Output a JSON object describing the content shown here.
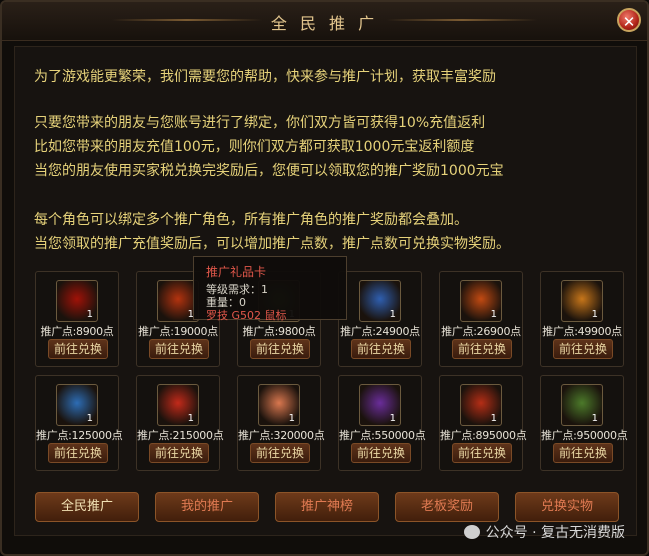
{
  "window": {
    "title": "全 民 推 广",
    "close_glyph": "✕"
  },
  "messages": [
    "为了游戏能更繁荣，我们需要您的帮助，快来参与推广计划，获取丰富奖励",
    "只要您带来的朋友与您账号进行了绑定，你们双方皆可获得10%充值返利",
    "比如您带来的朋友充值100元，则你们双方都可获取1000元宝返利额度",
    "当您的朋友使用买家税兑换完奖励后，您便可以领取您的推广奖励1000元宝",
    "每个角色可以绑定多个推广角色，所有推广角色的推广奖励都会叠加。",
    "当您领取的推广充值奖励后，可以增加推广点数，推广点数可兑换实物奖励。"
  ],
  "redeem_label": "前往兑换",
  "rewards": [
    {
      "cost": "推广点:8900点",
      "qty": "1",
      "icon": "red-envelope-icon",
      "color": "#a01208"
    },
    {
      "cost": "推广点:19000点",
      "qty": "1",
      "icon": "red-envelope-gold-icon",
      "color": "#b3330f"
    },
    {
      "cost": "推广点:9800点",
      "qty": "1",
      "icon": "gift-card-icon",
      "color": "#3c7a2c"
    },
    {
      "cost": "推广点:24900点",
      "qty": "1",
      "icon": "envelope-blue-glow-icon",
      "color": "#2f5fb0"
    },
    {
      "cost": "推广点:26900点",
      "qty": "1",
      "icon": "envelope-ornate-icon",
      "color": "#c24a12"
    },
    {
      "cost": "推广点:49900点",
      "qty": "1",
      "icon": "treasure-box-icon",
      "color": "#c7761a"
    },
    {
      "cost": "推广点:125000点",
      "qty": "1",
      "icon": "gift-box-blue-icon",
      "color": "#2d6db5"
    },
    {
      "cost": "推广点:215000点",
      "qty": "1",
      "icon": "lantern-red-icon",
      "color": "#c22a1a"
    },
    {
      "cost": "推广点:320000点",
      "qty": "1",
      "icon": "lantern-flower-icon",
      "color": "#d9774f"
    },
    {
      "cost": "推广点:550000点",
      "qty": "1",
      "icon": "gift-box-purple-icon",
      "color": "#6a2d9a"
    },
    {
      "cost": "推广点:895000点",
      "qty": "1",
      "icon": "gift-pouch-red-icon",
      "color": "#b52e16"
    },
    {
      "cost": "推广点:950000点",
      "qty": "1",
      "icon": "gift-box-gold-icon",
      "color": "#4c7a2a"
    }
  ],
  "tooltip": {
    "name": "推广礼品卡",
    "level": "等级需求：1",
    "weight": "重量：0",
    "brand": "罗技 G502 鼠标"
  },
  "tabs": [
    "全民推广",
    "我的推广",
    "推广神榜",
    "老板奖励",
    "兑换实物"
  ],
  "watermark": "公众号 · 复古无消费版",
  "colors": {
    "gold_text": "#e6d27a",
    "active_tab_text": "#f2e2b5",
    "inactive_tab_text": "#e07a52",
    "tooltip_name": "#e0574a"
  }
}
